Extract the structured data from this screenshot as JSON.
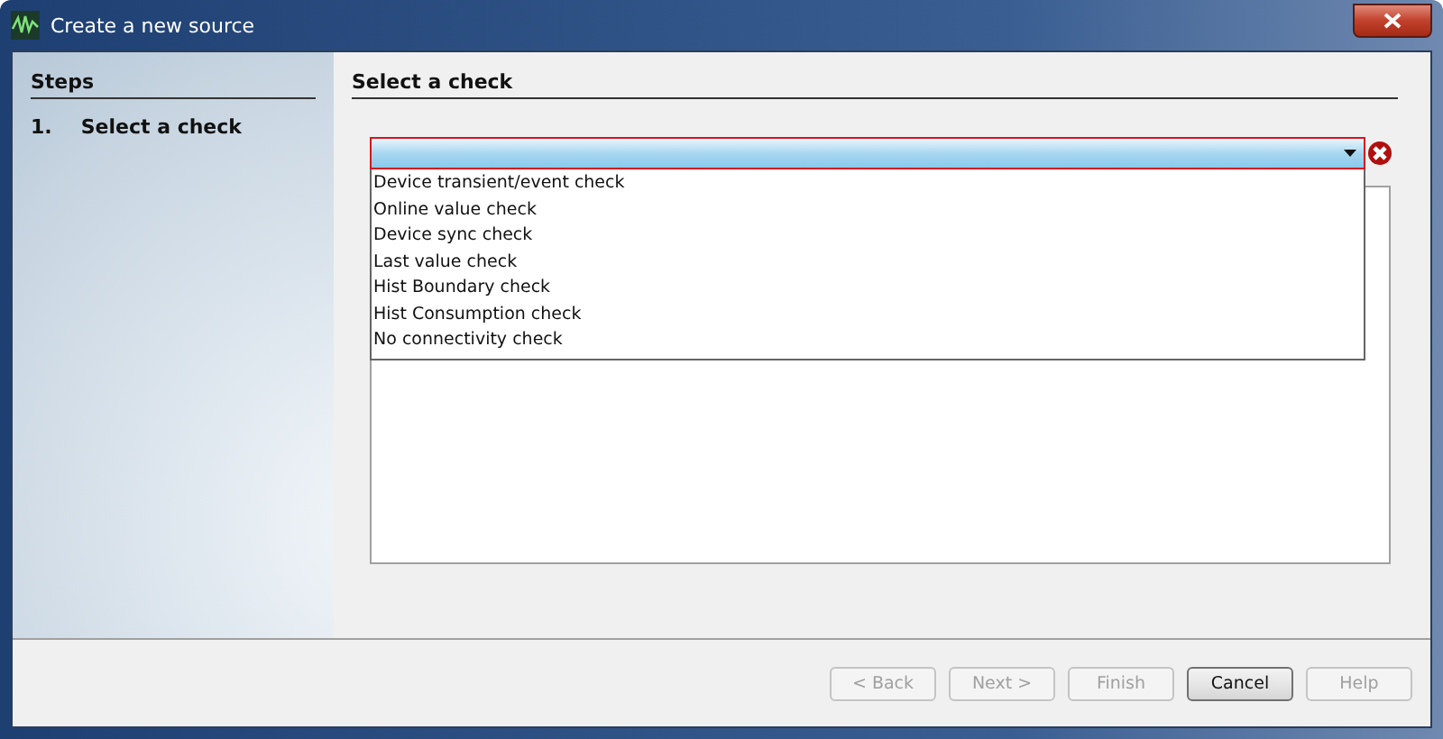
{
  "window": {
    "title": "Create a new source"
  },
  "steps": {
    "title": "Steps",
    "items": [
      {
        "number": "1.",
        "label": "Select a check",
        "selected": true
      }
    ]
  },
  "page": {
    "title": "Select a check"
  },
  "dropdown": {
    "open": true,
    "options": [
      {
        "label": "Device transient/event check",
        "selected": false
      },
      {
        "label": "Online value check",
        "selected": false
      },
      {
        "label": "Device sync check",
        "selected": false
      },
      {
        "label": "Last value check",
        "selected": false
      },
      {
        "label": "Hist Boundary check",
        "selected": false
      },
      {
        "label": "Hist Consumption check",
        "selected": false
      },
      {
        "label": "No connectivity check",
        "selected": false
      }
    ]
  },
  "buttons": [
    {
      "label": "< Back",
      "disabled": true
    },
    {
      "label": "Next >",
      "disabled": true
    },
    {
      "label": "Finish",
      "disabled": true
    },
    {
      "label": "Cancel",
      "disabled": false
    },
    {
      "label": "Help",
      "disabled": true
    }
  ]
}
